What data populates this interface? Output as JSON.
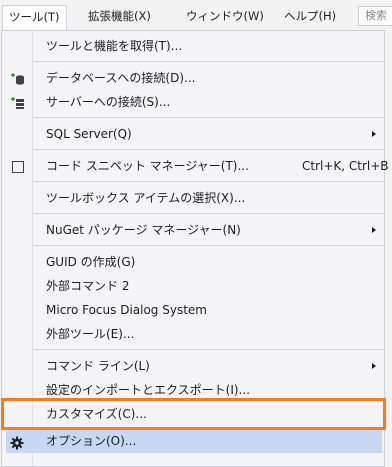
{
  "menubar": {
    "items": [
      {
        "label": "ツール(T)"
      },
      {
        "label": "拡張機能(X)"
      },
      {
        "label": "ウィンドウ(W)"
      },
      {
        "label": "ヘルプ(H)"
      }
    ],
    "search_text": "検索"
  },
  "menu": {
    "items": [
      {
        "label": "ツールと機能を取得(T)..."
      },
      {
        "label": "データベースへの接続(D)...",
        "icon": "database-connect-icon"
      },
      {
        "label": "サーバーへの接続(S)...",
        "icon": "server-connect-icon"
      },
      {
        "label": "SQL Server(Q)",
        "submenu": true
      },
      {
        "label": "コード スニペット マネージャー(T)...",
        "shortcut": "Ctrl+K, Ctrl+B",
        "icon": "checkbox-icon"
      },
      {
        "label": "ツールボックス アイテムの選択(X)..."
      },
      {
        "label": "NuGet パッケージ マネージャー(N)",
        "submenu": true
      },
      {
        "label": "GUID の作成(G)"
      },
      {
        "label": "外部コマンド 2"
      },
      {
        "label": "Micro Focus Dialog System"
      },
      {
        "label": "外部ツール(E)..."
      },
      {
        "label": "コマンド ライン(L)",
        "submenu": true
      },
      {
        "label": "設定のインポートとエクスポート(I)..."
      },
      {
        "label": "カスタマイズ(C)..."
      },
      {
        "label": "オプション(O)...",
        "icon": "gear-icon",
        "highlighted": true
      }
    ]
  },
  "colors": {
    "highlight": "#c7d8f3",
    "focus_outline": "#ef7d22",
    "menu_bg": "#f5f5f7"
  }
}
